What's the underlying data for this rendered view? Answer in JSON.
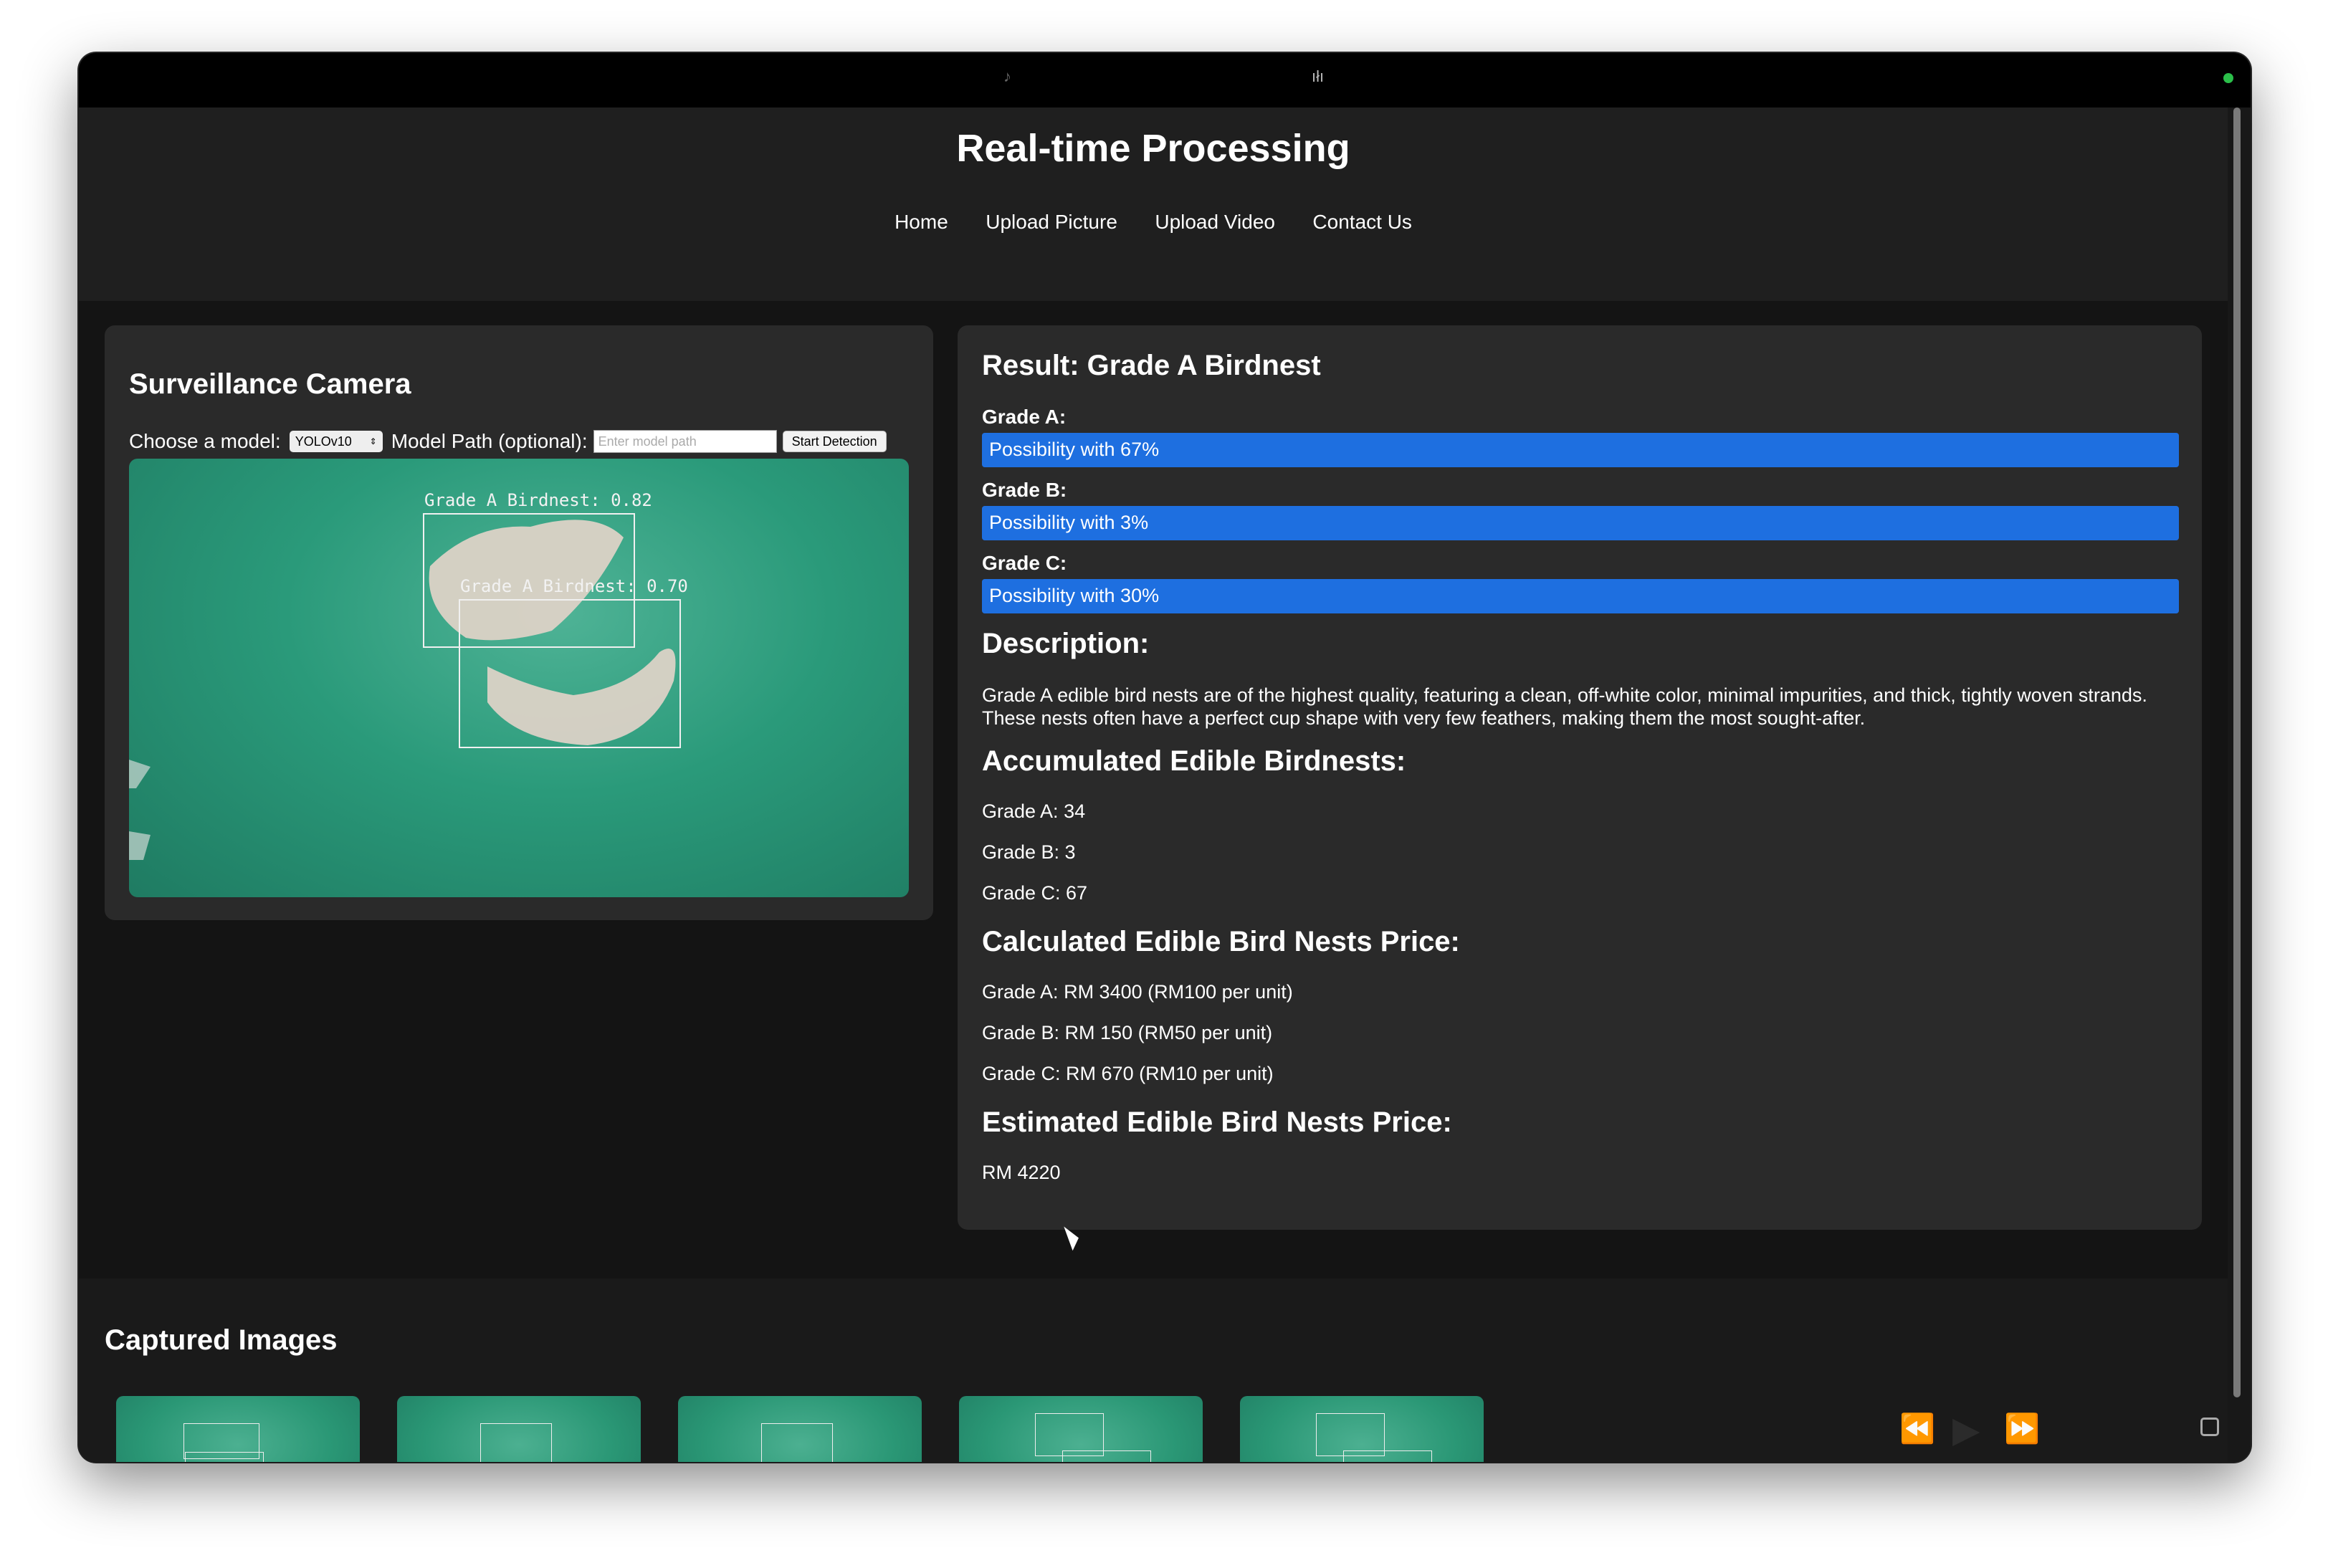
{
  "header": {
    "title": "Real-time Processing",
    "nav": [
      "Home",
      "Upload Picture",
      "Upload Video",
      "Contact Us"
    ]
  },
  "camera": {
    "title": "Surveillance Camera",
    "model_label": "Choose a model:",
    "model_selected": "YOLOv10",
    "path_label": "Model Path (optional):",
    "path_placeholder": "Enter model path",
    "start_button": "Start Detection",
    "detections": [
      {
        "label": "Grade A Birdnest: 0.82"
      },
      {
        "label": "Grade A Birdnest: 0.70"
      }
    ]
  },
  "result": {
    "title": "Result: Grade A Birdnest",
    "grades": [
      {
        "label": "Grade A:",
        "text": "Possibility with 67%",
        "value": 67
      },
      {
        "label": "Grade B:",
        "text": "Possibility with 3%",
        "value": 3
      },
      {
        "label": "Grade C:",
        "text": "Possibility with 30%",
        "value": 30
      }
    ],
    "description_title": "Description:",
    "description": "Grade A edible bird nests are of the highest quality, featuring a clean, off-white color, minimal impurities, and thick, tightly woven strands. These nests often have a perfect cup shape with very few feathers, making them the most sought-after.",
    "accumulated_title": "Accumulated Edible Birdnests:",
    "accumulated": [
      "Grade A: 34",
      "Grade B: 3",
      "Grade C: 67"
    ],
    "calculated_title": "Calculated Edible Bird Nests Price:",
    "calculated": [
      "Grade A: RM 3400 (RM100 per unit)",
      "Grade B: RM 150 (RM50 per unit)",
      "Grade C: RM 670 (RM10 per unit)"
    ],
    "estimated_title": "Estimated Edible Bird Nests Price:",
    "estimated": "RM 4220"
  },
  "captured": {
    "title": "Captured Images"
  },
  "colors": {
    "bar_fill": "#1e6fe0",
    "panel": "#2a2a2a",
    "background": "#141414"
  }
}
